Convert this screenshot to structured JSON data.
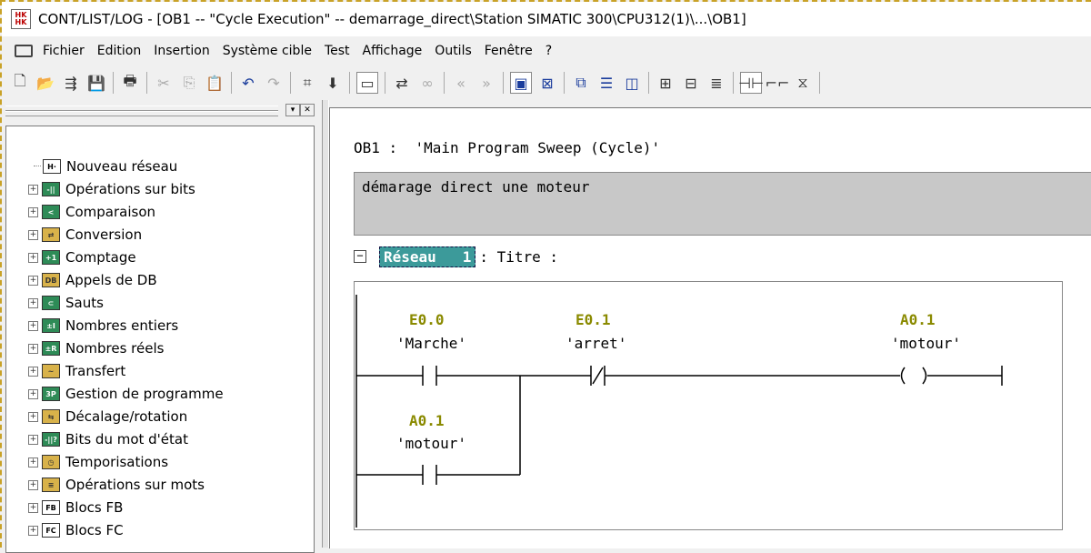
{
  "window": {
    "title": "CONT/LIST/LOG - [OB1 -- \"Cycle Execution\" -- demarrage_direct\\Station SIMATIC 300\\CPU312(1)\\...\\OB1]"
  },
  "menu": [
    "Fichier",
    "Edition",
    "Insertion",
    "Système cible",
    "Test",
    "Affichage",
    "Outils",
    "Fenêtre",
    "?"
  ],
  "tree": [
    {
      "label": "Nouveau réseau",
      "icon": "new-network-icon",
      "expandable": false
    },
    {
      "label": "Opérations sur bits",
      "icon": "bit-ops-icon",
      "expandable": true
    },
    {
      "label": "Comparaison",
      "icon": "compare-icon",
      "expandable": true
    },
    {
      "label": "Conversion",
      "icon": "conversion-icon",
      "expandable": true
    },
    {
      "label": "Comptage",
      "icon": "counter-icon",
      "expandable": true
    },
    {
      "label": "Appels de DB",
      "icon": "db-call-icon",
      "expandable": true
    },
    {
      "label": "Sauts",
      "icon": "jump-icon",
      "expandable": true
    },
    {
      "label": "Nombres entiers",
      "icon": "integer-icon",
      "expandable": true
    },
    {
      "label": "Nombres réels",
      "icon": "real-icon",
      "expandable": true
    },
    {
      "label": "Transfert",
      "icon": "transfer-icon",
      "expandable": true
    },
    {
      "label": "Gestion de programme",
      "icon": "program-control-icon",
      "expandable": true
    },
    {
      "label": "Décalage/rotation",
      "icon": "shift-icon",
      "expandable": true
    },
    {
      "label": "Bits du mot d'état",
      "icon": "status-bits-icon",
      "expandable": true
    },
    {
      "label": "Temporisations",
      "icon": "timer-icon",
      "expandable": true
    },
    {
      "label": "Opérations sur mots",
      "icon": "word-ops-icon",
      "expandable": true
    },
    {
      "label": "Blocs FB",
      "icon": "fb-block-icon",
      "expandable": true
    },
    {
      "label": "Blocs FC",
      "icon": "fc-block-icon",
      "expandable": true
    }
  ],
  "editor": {
    "ob_prefix": "OB1",
    "ob_title": " :  'Main Program Sweep (Cycle)'",
    "comment": "démarage direct une moteur",
    "network_label": "Réseau   1",
    "network_title": ": Titre :",
    "contacts": [
      {
        "address": "E0.0",
        "symbol": "'Marche'",
        "type": "normally-open"
      },
      {
        "address": "E0.1",
        "symbol": "'arret'",
        "type": "normally-closed"
      },
      {
        "address": "A0.1",
        "symbol": "'motour'",
        "type": "normally-open"
      }
    ],
    "coil": {
      "address": "A0.1",
      "symbol": "'motour'"
    }
  },
  "colors": {
    "address": "#8a8a00",
    "network_tag": "#3c9a9a",
    "comment_bg": "#c8c8c8"
  }
}
